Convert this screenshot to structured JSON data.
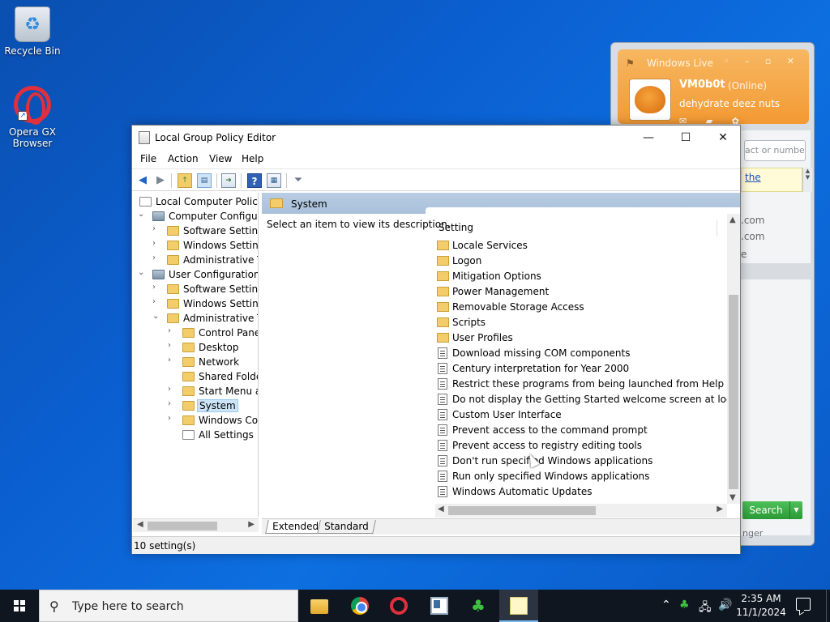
{
  "desktop": {
    "icons": [
      {
        "label": "Recycle Bin"
      },
      {
        "label": "Opera GX Browser"
      }
    ]
  },
  "messenger": {
    "title": "Windows Live",
    "controls": "◦ – ▫ ✕",
    "display_name": "VM0b0t",
    "status": "(Online)",
    "personal_message": "dehydrate deez nuts",
    "search_placeholder": "act or numbe",
    "note_link": "the",
    "contact_1": ".com",
    "contact_2": ".com",
    "contact_3": "e",
    "search_button": "Search",
    "footer": "nger"
  },
  "window": {
    "title": "Local Group Policy Editor",
    "controls": {
      "minimize": "—",
      "maximize": "☐",
      "close": "✕"
    },
    "menu": [
      "File",
      "Action",
      "View",
      "Help"
    ],
    "tree": [
      {
        "label": "Local Computer Policy",
        "expander": "",
        "icon": "doc"
      },
      {
        "label": "Computer Configura",
        "expander": "⌄",
        "icon": "comp"
      },
      {
        "label": "Software Settings",
        "expander": "›",
        "icon": "folder"
      },
      {
        "label": "Windows Setting",
        "expander": "›",
        "icon": "folder"
      },
      {
        "label": "Administrative Te",
        "expander": "›",
        "icon": "folder"
      },
      {
        "label": "User Configuration",
        "expander": "⌄",
        "icon": "comp"
      },
      {
        "label": "Software Settings",
        "expander": "›",
        "icon": "folder"
      },
      {
        "label": "Windows Setting",
        "expander": "›",
        "icon": "folder"
      },
      {
        "label": "Administrative Te",
        "expander": "⌄",
        "icon": "folder"
      },
      {
        "label": "Control Panel",
        "expander": "›",
        "icon": "folder"
      },
      {
        "label": "Desktop",
        "expander": "›",
        "icon": "folder"
      },
      {
        "label": "Network",
        "expander": "›",
        "icon": "folder"
      },
      {
        "label": "Shared Folder",
        "expander": "",
        "icon": "folder"
      },
      {
        "label": "Start Menu ar",
        "expander": "›",
        "icon": "folder"
      },
      {
        "label": "System",
        "expander": "›",
        "icon": "folder",
        "selected": true
      },
      {
        "label": "Windows Cor",
        "expander": "›",
        "icon": "folder"
      },
      {
        "label": "All Settings",
        "expander": "",
        "icon": "doc"
      }
    ],
    "panel_header": "System",
    "description": "Select an item to view its description.",
    "column_header": "Setting",
    "settings": [
      {
        "label": "Locale Services",
        "type": "folder"
      },
      {
        "label": "Logon",
        "type": "folder"
      },
      {
        "label": "Mitigation Options",
        "type": "folder"
      },
      {
        "label": "Power Management",
        "type": "folder"
      },
      {
        "label": "Removable Storage Access",
        "type": "folder"
      },
      {
        "label": "Scripts",
        "type": "folder"
      },
      {
        "label": "User Profiles",
        "type": "folder"
      },
      {
        "label": "Download missing COM components",
        "type": "policy"
      },
      {
        "label": "Century interpretation for Year 2000",
        "type": "policy"
      },
      {
        "label": "Restrict these programs from being launched from Help",
        "type": "policy"
      },
      {
        "label": "Do not display the Getting Started welcome screen at logon",
        "type": "policy"
      },
      {
        "label": "Custom User Interface",
        "type": "policy"
      },
      {
        "label": "Prevent access to the command prompt",
        "type": "policy"
      },
      {
        "label": "Prevent access to registry editing tools",
        "type": "policy"
      },
      {
        "label": "Don't run specified Windows applications",
        "type": "policy"
      },
      {
        "label": "Run only specified Windows applications",
        "type": "policy"
      },
      {
        "label": "Windows Automatic Updates",
        "type": "policy"
      }
    ],
    "tabs": [
      {
        "label": "Extended",
        "active": true
      },
      {
        "label": "Standard",
        "active": false
      }
    ],
    "status": "10 setting(s)"
  },
  "taskbar": {
    "search_placeholder": "Type here to search",
    "apps": [
      {
        "name": "file-explorer"
      },
      {
        "name": "chrome"
      },
      {
        "name": "opera-gx"
      },
      {
        "name": "window-app"
      },
      {
        "name": "windows-live-messenger"
      },
      {
        "name": "notepad",
        "active": true
      }
    ],
    "time": "2:35 AM",
    "date": "11/1/2024"
  }
}
